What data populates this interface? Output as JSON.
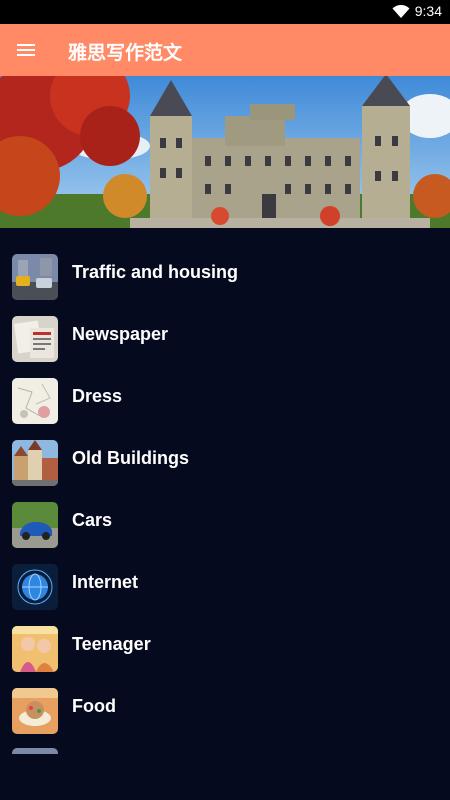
{
  "status_bar": {
    "time": "9:34",
    "wifi_icon": "wifi-icon"
  },
  "toolbar": {
    "title": "雅思写作范文",
    "menu_icon": "menu-icon"
  },
  "banner": {
    "image": "castle-autumn-photo"
  },
  "topics": [
    {
      "label": "Traffic and housing",
      "icon": "traffic-thumbnail"
    },
    {
      "label": "Newspaper",
      "icon": "newspaper-thumbnail"
    },
    {
      "label": "Dress",
      "icon": "dress-thumbnail"
    },
    {
      "label": "Old Buildings",
      "icon": "old-buildings-thumbnail"
    },
    {
      "label": "Cars",
      "icon": "cars-thumbnail"
    },
    {
      "label": "Internet",
      "icon": "internet-thumbnail"
    },
    {
      "label": "Teenager",
      "icon": "teenager-thumbnail"
    },
    {
      "label": "Food",
      "icon": "food-thumbnail"
    }
  ],
  "colors": {
    "toolbar": "#ff8a65",
    "list_background": "#050a1e",
    "status_bar": "#000000",
    "text": "#ffffff"
  }
}
